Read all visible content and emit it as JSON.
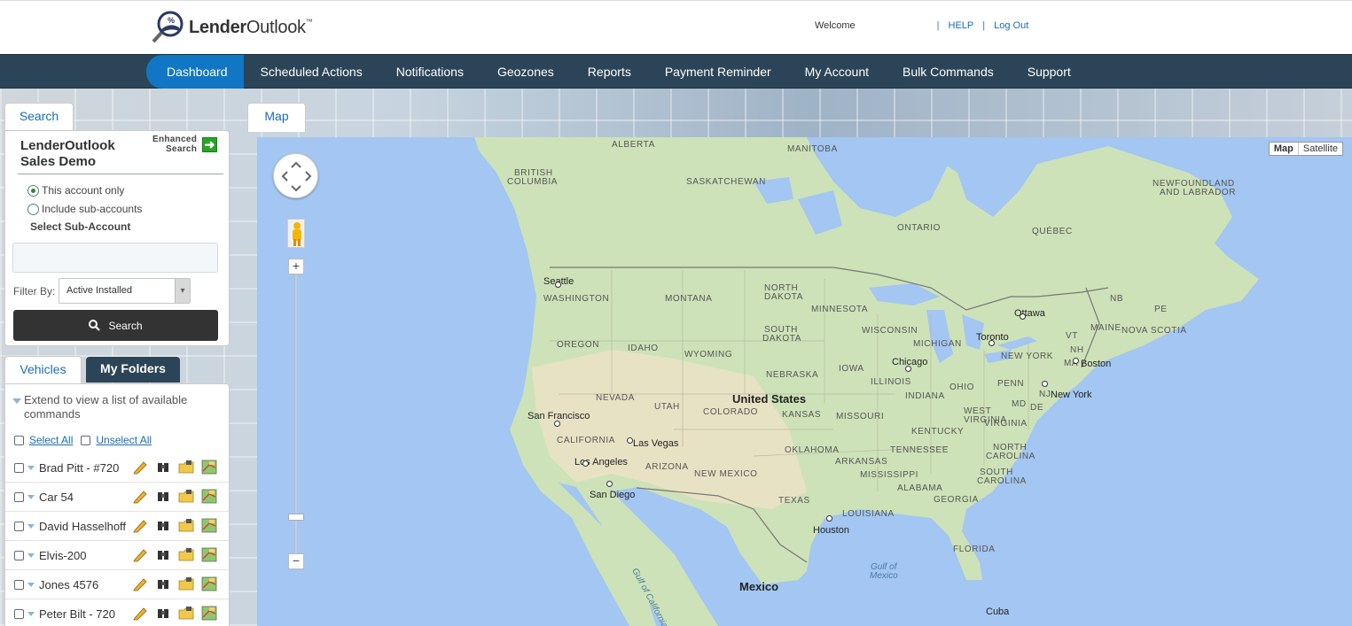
{
  "brand": {
    "logo_text_bold": "Lender",
    "logo_text_light": "Outlook",
    "tm": "™"
  },
  "header": {
    "welcome": "Welcome",
    "sep": "|",
    "help": "HELP",
    "logout": "Log Out"
  },
  "nav": {
    "items": [
      "Dashboard",
      "Scheduled Actions",
      "Notifications",
      "Geozones",
      "Reports",
      "Payment Reminder",
      "My Account",
      "Bulk Commands",
      "Support"
    ],
    "active": "Dashboard"
  },
  "search_panel": {
    "tab_label": "Search",
    "account_name": "LenderOutlook Sales Demo",
    "enhanced_search_line1": "Enhanced",
    "enhanced_search_line2": "Search",
    "radio_this_account": "This account only",
    "radio_sub_accounts": "Include sub-accounts",
    "select_sub_account": "Select Sub-Account",
    "sub_account_value": "",
    "filter_label": "Filter By:",
    "filter_value": "Active Installed",
    "search_button": "Search"
  },
  "vehicles_panel": {
    "tab_vehicles": "Vehicles",
    "tab_folders": "My Folders",
    "extend_text": "Extend to view a list of available commands",
    "select_all": "Select All",
    "unselect_all": "Unselect All",
    "vehicles": [
      "Brad Pitt - #720",
      "Car 54",
      "David Hasselhoff",
      "Elvis-200",
      "Jones 4576",
      "Peter Bilt - 720"
    ]
  },
  "map": {
    "tab_label": "Map",
    "type_map": "Map",
    "type_satellite": "Satellite",
    "colors": {
      "water": "#a3c6f2",
      "land": "#cde2b8",
      "desert": "#e8e2c4",
      "border": "#777777"
    },
    "labels": {
      "alberta": "ALBERTA",
      "manitoba": "MANITOBA",
      "bc1": "BRITISH",
      "bc2": "COLUMBIA",
      "saskatchewan": "SASKATCHEWAN",
      "nl1": "NEWFOUNDLAND",
      "nl2": "AND LABRADOR",
      "ontario": "ONTARIO",
      "quebec": "QUÉBEC",
      "seattle": "Seattle",
      "washington": "WASHINGTON",
      "montana": "MONTANA",
      "nd1": "NORTH",
      "nd2": "DAKOTA",
      "minnesota": "MINNESOTA",
      "ottawa": "Ottawa",
      "nb": "NB",
      "pe": "PE",
      "maine": "MAINE",
      "nova_scotia": "NOVA SCOTIA",
      "vt": "VT",
      "nh": "NH",
      "ma": "MA",
      "boston": "Boston",
      "oregon": "OREGON",
      "idaho": "IDAHO",
      "sd1": "SOUTH",
      "sd2": "DAKOTA",
      "wisconsin": "WISCONSIN",
      "michigan": "MICHIGAN",
      "toronto": "Toronto",
      "new_york_state": "NEW YORK",
      "wyoming": "WYOMING",
      "iowa": "IOWA",
      "nebraska": "NEBRASKA",
      "chicago": "Chicago",
      "penn": "PENN",
      "new_york_city": "New York",
      "nevada": "NEVADA",
      "utah": "UTAH",
      "united_states": "United States",
      "illinois": "ILLINOIS",
      "indiana": "INDIANA",
      "ohio": "OHIO",
      "md": "MD",
      "nj": "NJ",
      "de": "DE",
      "san_francisco": "San Francisco",
      "colorado": "COLORADO",
      "kansas": "KANSAS",
      "missouri": "MISSOURI",
      "wv1": "WEST",
      "wv2": "VIRGINIA",
      "virginia": "VIRGINIA",
      "kentucky": "KENTUCKY",
      "california": "CALIFORNIA",
      "las_vegas": "Las Vegas",
      "nc1": "NORTH",
      "nc2": "CAROLINA",
      "oklahoma": "OKLAHOMA",
      "tennessee": "TENNESSEE",
      "los_angeles": "Los Angeles",
      "arizona": "ARIZONA",
      "new_mexico": "NEW MEXICO",
      "arkansas": "ARKANSAS",
      "sc1": "SOUTH",
      "sc2": "CAROLINA",
      "mississippi": "MISSISSIPPI",
      "alabama": "ALABAMA",
      "georgia": "GEORGIA",
      "san_diego": "San Diego",
      "texas": "TEXAS",
      "louisiana": "LOUISIANA",
      "houston": "Houston",
      "gulf_california": "Gulf of California",
      "florida": "FLORIDA",
      "gulf_mexico1": "Gulf of",
      "gulf_mexico2": "Mexico",
      "mexico": "Mexico",
      "cuba": "Cuba"
    }
  }
}
